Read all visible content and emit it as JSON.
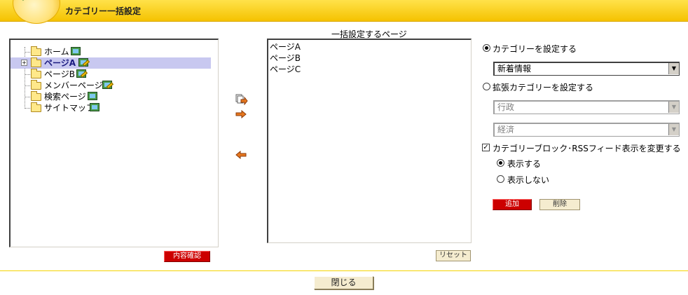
{
  "header": {
    "title": "カテゴリー一括設定"
  },
  "tree": {
    "items": [
      {
        "label": "ホーム",
        "icon": "monitor-icon"
      },
      {
        "label": "ページA",
        "icon": "monitor-edit-icon",
        "selected": true,
        "expander": "+"
      },
      {
        "label": "ページB",
        "icon": "monitor-edit-icon"
      },
      {
        "label": "メンバーページ",
        "icon": "monitor-edit-icon"
      },
      {
        "label": "検索ページ",
        "icon": "monitor-icon"
      },
      {
        "label": "サイトマップ",
        "icon": "monitor-icon"
      }
    ],
    "confirm_button": "内容確認"
  },
  "pages": {
    "caption": "一括設定するページ",
    "items": [
      "ページA",
      "ページB",
      "ページC"
    ],
    "reset_button": "リセット"
  },
  "options": {
    "category_radio": "カテゴリーを設定する",
    "category_select": "新着情報",
    "ext_category_radio": "拡張カテゴリーを設定する",
    "ext_select_1": "行政",
    "ext_select_2": "経済",
    "change_display_checkbox": "カテゴリーブロック･RSSフィード表示を変更する",
    "show_radio": "表示する",
    "hide_radio": "表示しない",
    "add_button": "追加",
    "delete_button": "削除"
  },
  "footer": {
    "close_button": "閉じる"
  },
  "colors": {
    "header": "#f5c200",
    "red_button": "#cc0000",
    "beige_button": "#f5eccf"
  }
}
